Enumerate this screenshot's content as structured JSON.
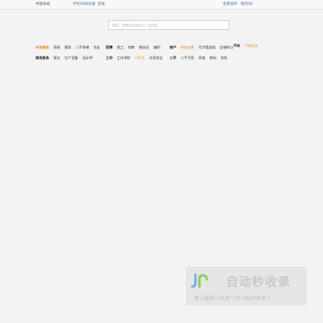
{
  "topbar": {
    "city": "中国本站",
    "mobile": "手机58同",
    "register": "注册",
    "login": "登录",
    "post_free": "免费发布",
    "my_58": "我的58"
  },
  "search": {
    "placeholder": "搜索：免费发布你的小广告信息"
  },
  "categories": [
    {
      "rows": [
        {
          "head": "本地服务",
          "head_hl": true,
          "items": [
            {
              "t": "家政",
              "hl": false
            },
            {
              "t": "搬家",
              "hl": false
            },
            {
              "t": "二手车辆",
              "hl": false
            },
            {
              "t": "交友",
              "hl": false
            }
          ]
        },
        {
          "head": "商务服务",
          "head_hl": false,
          "items": [
            {
              "t": "保洁",
              "hl": false
            },
            {
              "t": "生产设备",
              "hl": false
            },
            {
              "t": "设计师",
              "hl": false
            }
          ]
        }
      ]
    },
    {
      "rows": [
        {
          "head": "招聘",
          "head_hl": false,
          "items": [
            {
              "t": "普工",
              "hl": false
            },
            {
              "t": "销售",
              "hl": false
            },
            {
              "t": "服务员",
              "hl": false
            },
            {
              "t": "兼职",
              "hl": false
            }
          ]
        },
        {
          "head": "工作",
          "head_hl": false,
          "items": [
            {
              "t": "工作求职",
              "hl": false
            },
            {
              "t": "小时工",
              "hl": true
            },
            {
              "t": "在家创业",
              "hl": false
            }
          ]
        }
      ]
    },
    {
      "rows": [
        {
          "head": "房产",
          "head_hl": false,
          "items": [
            {
              "t": "新房出售",
              "hl": true
            },
            {
              "t": "写字楼出租",
              "hl": false
            },
            {
              "t": "店铺转让",
              "hl": false
            }
          ]
        },
        {
          "head": "二手",
          "head_hl": false,
          "items": [
            {
              "t": "二手手机",
              "hl": false
            },
            {
              "t": "家电",
              "hl": false
            },
            {
              "t": "数码",
              "hl": false
            },
            {
              "t": "农机",
              "hl": false
            }
          ]
        }
      ]
    },
    {
      "rows": [
        {
          "head": "汽车",
          "head_hl": false,
          "items": [
            {
              "t": "汽车买卖",
              "hl": true
            }
          ]
        }
      ]
    }
  ],
  "watermark": {
    "logo_icon": "jr-logo-icon",
    "title": "自动秒收录",
    "subtitle": "做上链接→来访一次→自动收录→"
  }
}
